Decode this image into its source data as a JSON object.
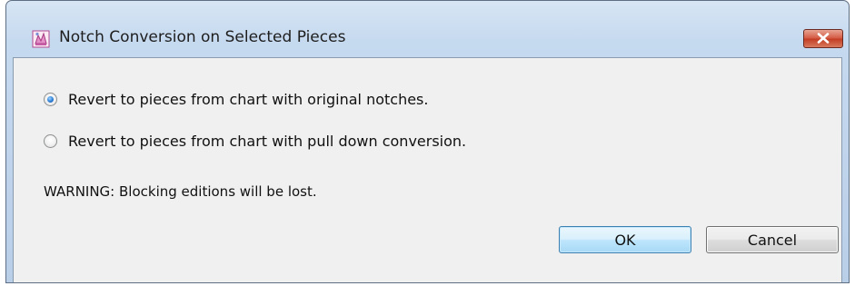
{
  "window": {
    "title": "Notch Conversion on Selected Pieces"
  },
  "options": [
    {
      "label": "Revert to pieces from chart with original notches.",
      "selected": true
    },
    {
      "label": "Revert to pieces from chart with pull down conversion.",
      "selected": false
    }
  ],
  "warning": "WARNING: Blocking editions will be lost.",
  "buttons": {
    "ok_label": "OK",
    "cancel_label": "Cancel"
  },
  "icons": {
    "app": "app-icon",
    "close": "close-icon"
  },
  "colors": {
    "close_button": "#c23c23",
    "ok_button_border": "#3c7fb1",
    "client_background": "#f0f0f0",
    "frame": "#c5d9ef"
  }
}
